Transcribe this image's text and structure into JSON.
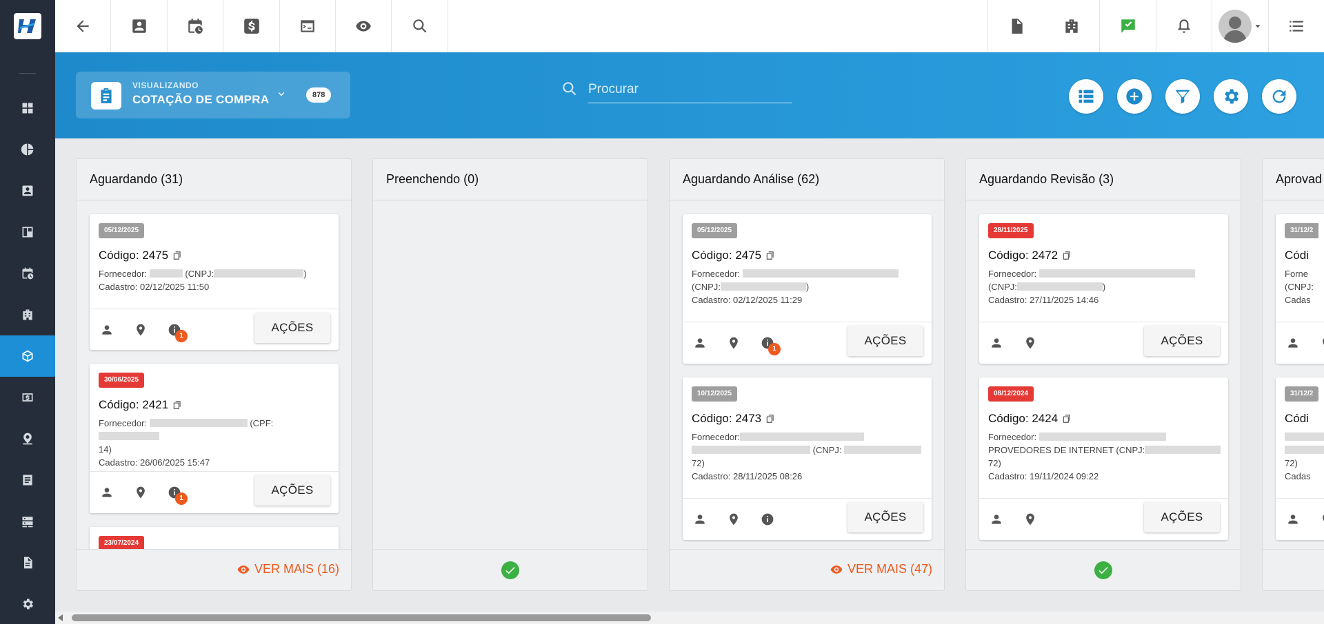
{
  "header": {
    "viewing_label": "VISUALIZANDO",
    "viewing_title": "COTAÇÃO DE COMPRA",
    "count": "878",
    "search_placeholder": "Procurar"
  },
  "actions_label": "AÇÕES",
  "columns": [
    {
      "title": "Aguardando (31)",
      "footer": "VER MAIS (16)",
      "cards": [
        {
          "date": "05/12/2025",
          "code": "Código: 2475",
          "supplier_prefix": "Fornecedor:",
          "tax_label": "(CNPJ:",
          "created": "Cadastro: 02/12/2025 11:50",
          "notif": "1"
        },
        {
          "date": "30/06/2025",
          "code": "Código: 2421",
          "supplier_prefix": "Fornecedor:",
          "tax_label": "(CPF:",
          "tax_tail": "14)",
          "created": "Cadastro: 26/06/2025 15:47",
          "notif": "1"
        },
        {
          "date": "23/07/2024"
        }
      ]
    },
    {
      "title": "Preenchendo (0)",
      "cards": []
    },
    {
      "title": "Aguardando Análise (62)",
      "footer": "VER MAIS (47)",
      "cards": [
        {
          "date": "05/12/2025",
          "code": "Código: 2475",
          "supplier_prefix": "Fornecedor:",
          "tax_label": "(CNPJ:",
          "tax_close": ")",
          "created": "Cadastro: 02/12/2025 11:29",
          "notif": "1"
        },
        {
          "date": "10/12/2025",
          "code": "Código: 2473",
          "supplier_prefix": "Fornecedor:",
          "tax_label": "(CNPJ:",
          "tax_tail": "72)",
          "created": "Cadastro: 28/11/2025 08:26"
        }
      ]
    },
    {
      "title": "Aguardando Revisão (3)",
      "cards": [
        {
          "date": "28/11/2025",
          "code": "Código: 2472",
          "supplier_prefix": "Fornecedor:",
          "tax_label": "(CNPJ:",
          "tax_close": ")",
          "created": "Cadastro: 27/11/2025 14:46"
        },
        {
          "date": "08/12/2024",
          "code": "Código: 2424",
          "supplier_prefix": "Fornecedor:",
          "supplier_rest": "PROVEDORES DE INTERNET (CNPJ:",
          "tax_tail": "72)",
          "created": "Cadastro: 19/11/2024 09:22"
        }
      ]
    },
    {
      "title": "Aprovad",
      "cards": [
        {
          "date": "31/12/2",
          "code": "Códi",
          "supplier_prefix": "Forne",
          "tax_label": "(CNPJ:",
          "created": "Cadas"
        },
        {
          "date": "31/12/2",
          "code": "Códi",
          "tax_tail": "72)",
          "created": "Cadas"
        }
      ]
    }
  ],
  "colors": {
    "accent": "#1e8acb",
    "sidebar": "#262d3a",
    "orange": "#ef5a1e",
    "red_badge": "#e53935",
    "gray_badge": "#9e9e9e",
    "green_check": "#3cb043"
  }
}
